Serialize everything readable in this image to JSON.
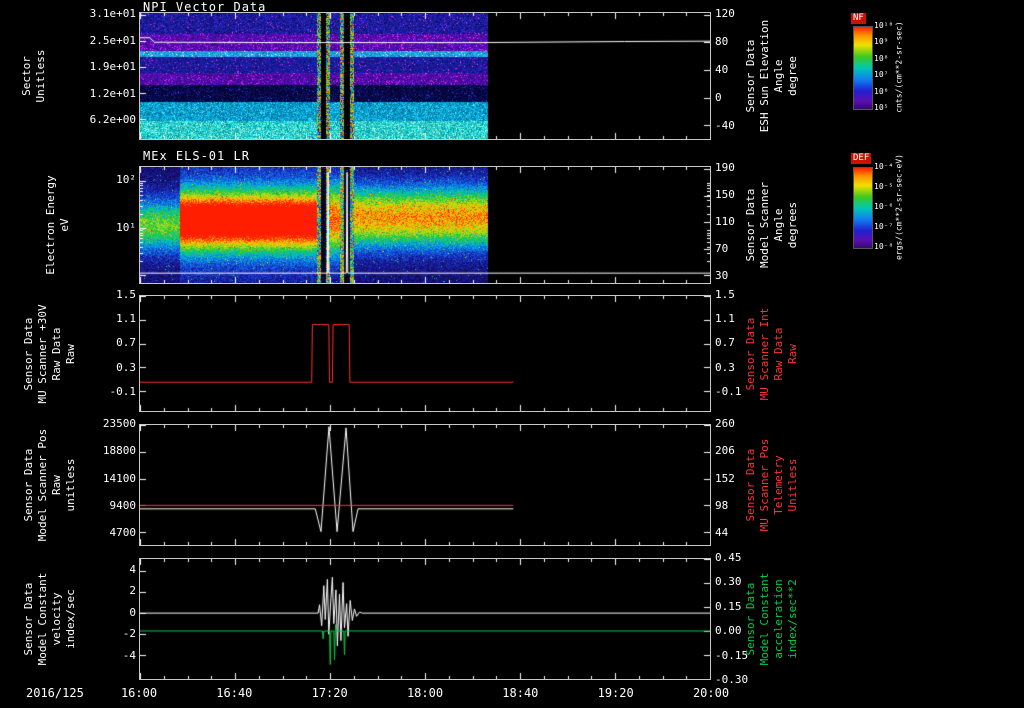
{
  "page": {
    "date_label": "2016/125",
    "background": "#000000",
    "foreground": "#ffffff"
  },
  "x_axis": {
    "ticks": [
      "16:00",
      "16:40",
      "17:20",
      "18:00",
      "18:40",
      "19:20",
      "20:00"
    ]
  },
  "panels": [
    {
      "title": "NPI Vector Data",
      "left_title": [
        "Sector",
        "Unitless"
      ],
      "left_ticks": [
        "3.1e+01",
        "2.5e+01",
        "1.9e+01",
        "1.2e+01",
        "6.2e+00"
      ],
      "right_ticks": [
        "120",
        "80",
        "40",
        "0",
        "-40"
      ],
      "right_title": [
        "Sensor Data",
        "ESH Sun Elevation",
        "Angle",
        "degree"
      ],
      "right_color": "#ffffff"
    },
    {
      "title": "MEx ELS-01 LR",
      "left_title": [
        "Electron Energy",
        "eV"
      ],
      "left_ticks": [
        "10²",
        "10¹"
      ],
      "right_ticks": [
        "190",
        "150",
        "110",
        "70",
        "30"
      ],
      "right_title": [
        "Sensor Data",
        "Model Scanner",
        "Angle",
        "degrees"
      ],
      "right_color": "#ffffff"
    },
    {
      "title": "",
      "left_title": [
        "Sensor Data",
        "MU Scanner +30V",
        "Raw Data",
        "Raw"
      ],
      "left_ticks": [
        "1.5",
        "1.1",
        "0.7",
        "0.3",
        "-0.1"
      ],
      "right_ticks": [
        "1.5",
        "1.1",
        "0.7",
        "0.3",
        "-0.1"
      ],
      "right_title": [
        "Sensor Data",
        "MU Scanner Int",
        "Raw Data",
        "Raw"
      ],
      "right_color": "#ff3333"
    },
    {
      "title": "",
      "left_title": [
        "Sensor Data",
        "Model Scanner Pos",
        "Raw",
        "unitless"
      ],
      "left_ticks": [
        "23500",
        "18800",
        "14100",
        "9400",
        "4700"
      ],
      "right_ticks": [
        "260",
        "206",
        "152",
        "98",
        "44"
      ],
      "right_title": [
        "Sensor Data",
        "MU Scanner Pos",
        "Telemetry",
        "Unitless"
      ],
      "right_color": "#ff3333"
    },
    {
      "title": "",
      "left_title": [
        "Sensor Data",
        "Model Constant",
        "velocity",
        "index/sec"
      ],
      "left_ticks": [
        "4",
        "2",
        "0",
        "-2",
        "-4"
      ],
      "right_ticks": [
        "0.45",
        "0.30",
        "0.15",
        "0.00",
        "-0.15",
        "-0.30"
      ],
      "right_title": [
        "Sensor Data",
        "Model Constant",
        "acceleration",
        "index/sec**2"
      ],
      "right_color": "#00cc44"
    }
  ],
  "colorbars": [
    {
      "name": "NF",
      "ticks": [
        "10¹⁰",
        "10⁹",
        "10⁸",
        "10⁷",
        "10⁶",
        "10⁵"
      ],
      "unit": "cnts/(cm**2-sr-sec)"
    },
    {
      "name": "DEF",
      "ticks": [
        "10⁻⁴",
        "10⁻⁵",
        "10⁻⁶",
        "10⁻⁷",
        "10⁻⁸"
      ],
      "unit": "ergs/(cm**2-sr-sec-eV)"
    }
  ],
  "chart_data": [
    {
      "type": "heatmap",
      "title": "NPI Vector Data",
      "ylabel": "Sector (Unitless)",
      "ylabel_right": "Sensor Data ESH Sun Elevation Angle (degree)",
      "yticks_left": [
        "3.1e+01",
        "2.5e+01",
        "1.9e+01",
        "1.2e+01",
        "6.2e+00"
      ],
      "yticks_right": [
        120,
        80,
        40,
        0,
        -40
      ],
      "xrange": [
        "16:00",
        "20:00"
      ],
      "data_end": "18:26",
      "event_gap": [
        "17:15",
        "17:30"
      ],
      "colorbar": "NF (cnts/(cm**2-sr-sec))",
      "summary": "Azimuthal-sector ENA spectrogram: upper sectors blue/purple with magenta bursts, lowest sectors bright cyan; saturated multicolor columns and telemetry dropout near 17:20; no data after ~18:26",
      "overlay_line": {
        "name": "ESH Sun Elevation Angle",
        "axis": "right",
        "color": "#ffffff",
        "points": [
          [
            16.0,
            87
          ],
          [
            16.07,
            87
          ],
          [
            16.1,
            80.5
          ],
          [
            17.0,
            80
          ],
          [
            18.4,
            80
          ],
          [
            18.8,
            80.6
          ],
          [
            19.4,
            81.5
          ],
          [
            20.0,
            82
          ]
        ]
      }
    },
    {
      "type": "heatmap",
      "title": "MEx ELS-01 LR",
      "ylabel": "Electron Energy (eV)",
      "ylabel_right": "Sensor Data Model Scanner Angle (degrees)",
      "yticks_left": [
        "10²",
        "10¹"
      ],
      "yticks_right": [
        190,
        150,
        110,
        70,
        30
      ],
      "xrange": [
        "16:00",
        "20:00"
      ],
      "data_end": "18:26",
      "event_gap": [
        "17:15",
        "17:30"
      ],
      "colorbar": "DEF (ergs/(cm**2-sr-sec-eV))",
      "summary": "Electron energy-time spectrogram: intense red flux 10-100 eV from ~16:25 to ~17:15, telemetry dropout with saturated columns 17:15-17:30, yellow-green flux after until ~18:26 over blue noise background",
      "overlay_line": {
        "name": "Model Scanner Angle",
        "axis": "right",
        "color": "#ffffff",
        "points": [
          [
            16.0,
            33
          ],
          [
            17.315,
            33
          ],
          [
            17.32,
            185
          ],
          [
            17.325,
            33
          ],
          [
            17.448,
            33
          ],
          [
            17.453,
            185
          ],
          [
            17.458,
            33
          ],
          [
            20.0,
            33
          ]
        ]
      }
    },
    {
      "type": "line",
      "title": "Sensor Data MU Scanner +30V Raw Data (Raw)",
      "ylim_left": [
        -0.43,
        1.5
      ],
      "yticks_left": [
        1.5,
        1.1,
        0.7,
        0.3,
        -0.1
      ],
      "ylim_right": [
        -0.43,
        1.5
      ],
      "yticks_right": [
        1.5,
        1.1,
        0.7,
        0.3,
        -0.1
      ],
      "series": [
        {
          "name": "MU Scanner Int Raw Data (Raw)",
          "axis": "left",
          "color": "#ff3333",
          "points": [
            [
              16.0,
              0.05
            ],
            [
              17.205,
              0.05
            ],
            [
              17.21,
              1.02
            ],
            [
              17.325,
              1.02
            ],
            [
              17.33,
              0.05
            ],
            [
              17.35,
              0.05
            ],
            [
              17.355,
              1.02
            ],
            [
              17.468,
              1.02
            ],
            [
              17.473,
              0.05
            ],
            [
              18.62,
              0.05
            ]
          ]
        }
      ]
    },
    {
      "type": "line",
      "title": "Sensor Data Model Scanner Pos (Raw, unitless)",
      "ylim_left": [
        2458,
        23500
      ],
      "yticks_left": [
        23500,
        18800,
        14100,
        9400,
        4700
      ],
      "ylim_right": [
        18.1,
        260
      ],
      "yticks_right": [
        260,
        206,
        152,
        98,
        44
      ],
      "series": [
        {
          "name": "Model Scanner Pos Raw",
          "axis": "left",
          "color": "#ffffff",
          "points": [
            [
              16.0,
              8800
            ],
            [
              17.23,
              8800
            ],
            [
              17.27,
              4800
            ],
            [
              17.326,
              23200
            ],
            [
              17.383,
              4800
            ],
            [
              17.446,
              23000
            ],
            [
              17.495,
              4800
            ],
            [
              17.53,
              8800
            ],
            [
              18.62,
              8800
            ]
          ]
        },
        {
          "name": "MU Scanner Pos Telemetry",
          "axis": "right",
          "color": "#ff3333",
          "points": [
            [
              16.0,
              98
            ],
            [
              18.62,
              98
            ]
          ]
        }
      ]
    },
    {
      "type": "line",
      "title": "Sensor Data Model Constant velocity (index/sec)",
      "ylim_left": [
        -6.23,
        5.12
      ],
      "yticks_left": [
        4,
        2,
        0,
        -2,
        -4
      ],
      "ylim_right": [
        -0.3,
        0.45
      ],
      "yticks_right": [
        0.45,
        0.3,
        0.15,
        0.0,
        -0.15,
        -0.3
      ],
      "series": [
        {
          "name": "Model Constant velocity",
          "axis": "left",
          "color": "#ffffff",
          "points": [
            [
              16.0,
              0
            ],
            [
              17.25,
              0
            ],
            [
              17.26,
              0.8
            ],
            [
              17.275,
              -1.2
            ],
            [
              17.29,
              2.6
            ],
            [
              17.3,
              -0.6
            ],
            [
              17.315,
              3.2
            ],
            [
              17.325,
              -2.0
            ],
            [
              17.34,
              1.4
            ],
            [
              17.35,
              3.4
            ],
            [
              17.36,
              -1.0
            ],
            [
              17.375,
              2.2
            ],
            [
              17.385,
              -3.1
            ],
            [
              17.4,
              1.8
            ],
            [
              17.41,
              -2.6
            ],
            [
              17.425,
              2.9
            ],
            [
              17.435,
              -1.4
            ],
            [
              17.45,
              0.9
            ],
            [
              17.46,
              -2.2
            ],
            [
              17.475,
              1.2
            ],
            [
              17.49,
              -0.7
            ],
            [
              17.505,
              0.4
            ],
            [
              17.52,
              -0.3
            ],
            [
              17.54,
              0.1
            ],
            [
              17.56,
              0
            ],
            [
              20.0,
              0
            ]
          ]
        },
        {
          "name": "Model Constant acceleration",
          "axis": "right",
          "color": "#00cc44",
          "points": [
            [
              16.0,
              0
            ],
            [
              17.28,
              0
            ],
            [
              17.285,
              -0.05
            ],
            [
              17.29,
              0
            ],
            [
              17.33,
              0
            ],
            [
              17.335,
              -0.21
            ],
            [
              17.34,
              0
            ],
            [
              17.36,
              0
            ],
            [
              17.365,
              -0.18
            ],
            [
              17.372,
              0.04
            ],
            [
              17.378,
              0
            ],
            [
              17.43,
              0
            ],
            [
              17.435,
              -0.15
            ],
            [
              17.44,
              0
            ],
            [
              20.0,
              0
            ]
          ]
        }
      ]
    }
  ],
  "render": {
    "spec_common": {
      "data_end": 0.609,
      "gaps": [
        [
          0.3105,
          0.331
        ],
        [
          0.352,
          0.373
        ]
      ],
      "brights": [
        0.3135,
        0.329,
        0.354,
        0.3705
      ],
      "bright_hw": 0.0035
    },
    "p1_bands": [
      {
        "y0": 0.0,
        "y1": 0.16,
        "colors": [
          "#1818a8",
          "#202098",
          "#101078",
          "#2828c0"
        ],
        "sp": "#ee22ee",
        "p": 0.03
      },
      {
        "y0": 0.16,
        "y1": 0.3,
        "colors": [
          "#5510b8",
          "#4a0ca4",
          "#3f0a90",
          "#660ed0"
        ],
        "sp": "#ee22ee",
        "p": 0.1
      },
      {
        "y0": 0.3,
        "y1": 0.345,
        "colors": [
          "#20a0e0",
          "#18b0d0",
          "#3090ff"
        ],
        "sp": "#ffffff",
        "p": 0.05
      },
      {
        "y0": 0.345,
        "y1": 0.47,
        "colors": [
          "#1a1a9a",
          "#141488",
          "#2222b0"
        ],
        "sp": "#dd22dd",
        "p": 0.04
      },
      {
        "y0": 0.47,
        "y1": 0.565,
        "colors": [
          "#4d0ca8",
          "#5a10c0",
          "#400a8c"
        ],
        "sp": "#ee22ee",
        "p": 0.08
      },
      {
        "y0": 0.565,
        "y1": 0.7,
        "colors": [
          "#05053a",
          "#0a0a52",
          "#020228",
          "#101066"
        ],
        "sp": "#2233cc",
        "p": 0.05
      },
      {
        "y0": 0.7,
        "y1": 0.855,
        "colors": [
          "#0898c8",
          "#06a8d8",
          "#0578b0",
          "#12b8e0"
        ],
        "sp": "#40e0ff",
        "p": 0.06
      },
      {
        "y0": 0.855,
        "y1": 1.01,
        "colors": [
          "#10c8d8",
          "#30dcd0",
          "#08b0b8",
          "#60e8cc"
        ],
        "sp": "#b0ffe0",
        "p": 0.08
      }
    ],
    "p2_regions": [
      {
        "x0": 0.0,
        "x1": 0.07,
        "amp": 0.55,
        "cy": 0.5,
        "sy": 0.16
      },
      {
        "x0": 0.07,
        "x1": 0.3105,
        "amp": 0.97,
        "cy": 0.46,
        "sy": 0.15,
        "amp2": 0.33,
        "sy2": 0.3
      },
      {
        "x0": 0.331,
        "x1": 0.352,
        "amp": 0.85,
        "cy": 0.45,
        "sy": 0.22
      },
      {
        "x0": 0.373,
        "x1": 0.609,
        "amp": 0.78,
        "cy": 0.43,
        "sy": 0.18
      }
    ]
  }
}
